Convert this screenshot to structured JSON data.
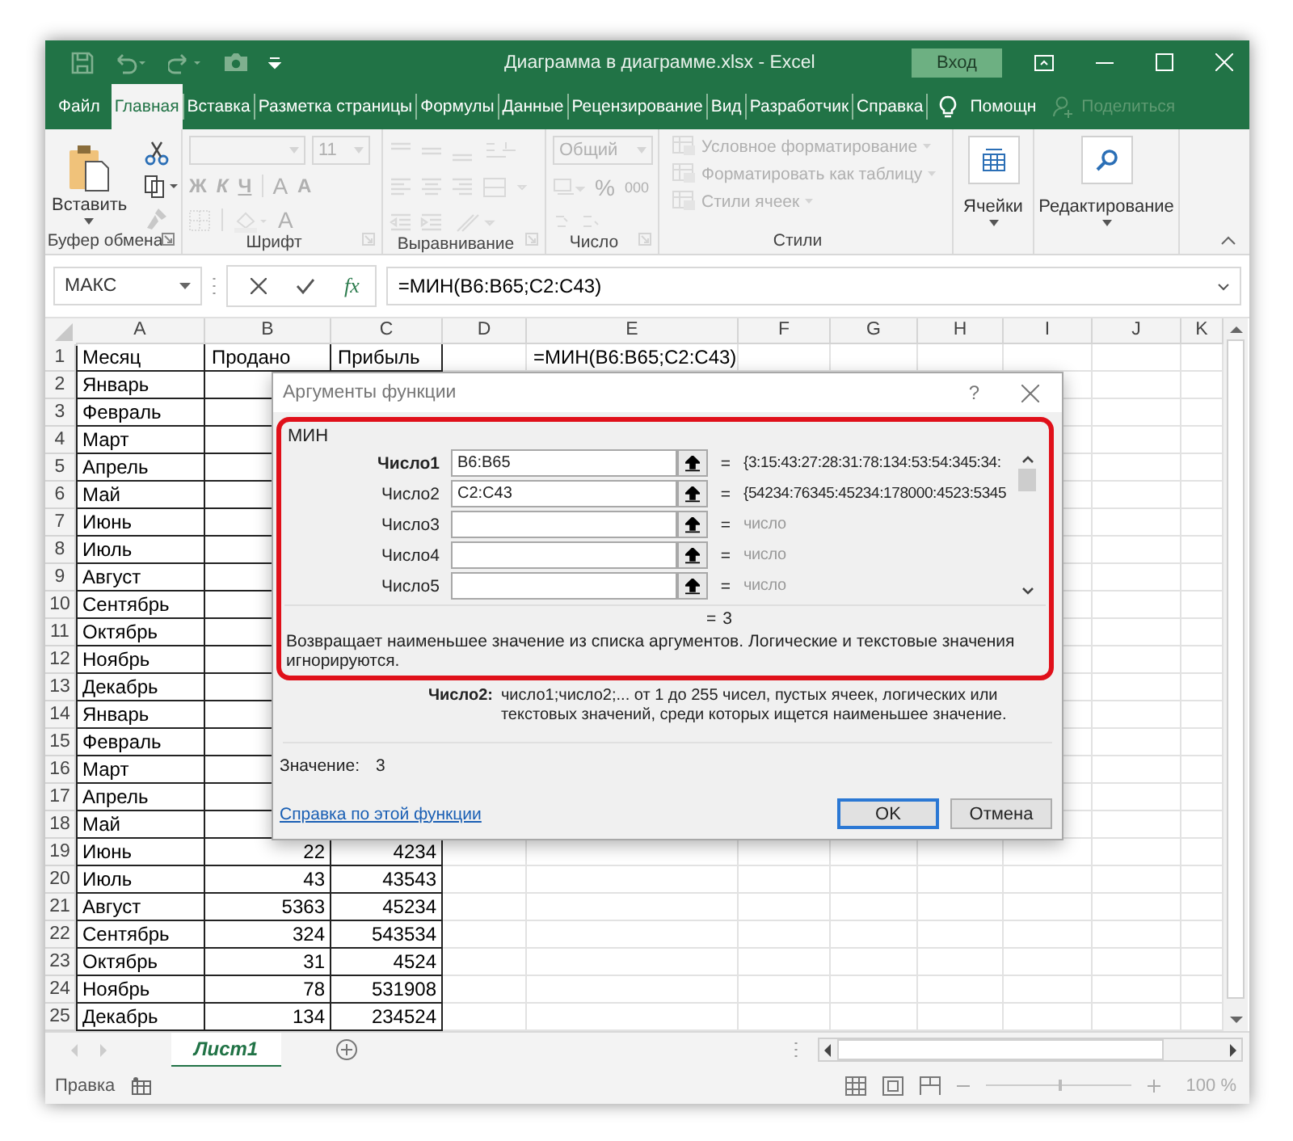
{
  "window": {
    "title": "Диаграмма в диаграмме.xlsx  -  Excel",
    "sign_in": "Вход"
  },
  "ribbon_tabs": [
    {
      "label": "Файл",
      "selected": false
    },
    {
      "label": "Главная",
      "selected": true
    },
    {
      "label": "Вставка",
      "selected": false
    },
    {
      "label": "Разметка страницы",
      "selected": false
    },
    {
      "label": "Формулы",
      "selected": false
    },
    {
      "label": "Данные",
      "selected": false
    },
    {
      "label": "Рецензирование",
      "selected": false
    },
    {
      "label": "Вид",
      "selected": false
    },
    {
      "label": "Разработчик",
      "selected": false
    },
    {
      "label": "Справка",
      "selected": false
    }
  ],
  "tell_me": "Помощн",
  "share": {
    "label": "Поделиться",
    "disabled": true
  },
  "ribbon": {
    "clipboard": {
      "label": "Буфер обмена",
      "paste": "Вставить",
      "disabled": false
    },
    "font": {
      "label": "Шрифт",
      "size": "11",
      "bold": "Ж",
      "italic": "К",
      "underline": "Ч",
      "grow": "A",
      "shrink": "A",
      "font_color": "A",
      "disabled": true
    },
    "alignment": {
      "label": "Выравнивание",
      "disabled": true
    },
    "number": {
      "label": "Число",
      "format": "Общий",
      "percent": "%",
      "thousands": "000",
      "disabled": true
    },
    "styles": {
      "label": "Стили",
      "items": [
        "Условное форматирование",
        "Форматировать как таблицу",
        "Стили ячеек"
      ],
      "disabled": true
    },
    "cells": {
      "label": "Ячейки",
      "disabled": false
    },
    "editing": {
      "label": "Редактирование",
      "disabled": false
    }
  },
  "formula_bar": {
    "name_box": "МАКС",
    "fx": "fx",
    "formula": "=МИН(B6:B65;C2:C43)"
  },
  "sheet": {
    "columns": [
      "A",
      "B",
      "C",
      "D",
      "E",
      "F",
      "G",
      "H",
      "I",
      "J",
      "K"
    ],
    "rows": [
      {
        "num": "1",
        "a": "Месяц",
        "b": "Продано",
        "c": "Прибыль",
        "e": "=МИН(B6:B65;C2:C43)"
      },
      {
        "num": "2",
        "a": "Январь"
      },
      {
        "num": "3",
        "a": "Февраль"
      },
      {
        "num": "4",
        "a": "Март"
      },
      {
        "num": "5",
        "a": "Апрель"
      },
      {
        "num": "6",
        "a": "Май"
      },
      {
        "num": "7",
        "a": "Июнь"
      },
      {
        "num": "8",
        "a": "Июль"
      },
      {
        "num": "9",
        "a": "Август"
      },
      {
        "num": "10",
        "a": "Сентябрь"
      },
      {
        "num": "11",
        "a": "Октябрь"
      },
      {
        "num": "12",
        "a": "Ноябрь"
      },
      {
        "num": "13",
        "a": "Декабрь"
      },
      {
        "num": "14",
        "a": "Январь"
      },
      {
        "num": "15",
        "a": "Февраль"
      },
      {
        "num": "16",
        "a": "Март"
      },
      {
        "num": "17",
        "a": "Апрель"
      },
      {
        "num": "18",
        "a": "Май"
      },
      {
        "num": "19",
        "a": "Июнь",
        "b": "22",
        "c": "4234"
      },
      {
        "num": "20",
        "a": "Июль",
        "b": "43",
        "c": "43543"
      },
      {
        "num": "21",
        "a": "Август",
        "b": "5363",
        "c": "45234"
      },
      {
        "num": "22",
        "a": "Сентябрь",
        "b": "324",
        "c": "543534"
      },
      {
        "num": "23",
        "a": "Октябрь",
        "b": "31",
        "c": "4524"
      },
      {
        "num": "24",
        "a": "Ноябрь",
        "b": "78",
        "c": "531908"
      },
      {
        "num": "25",
        "a": "Декабрь",
        "b": "134",
        "c": "234524"
      }
    ]
  },
  "dialog": {
    "title": "Аргументы функции",
    "help": "?",
    "function_name": "МИН",
    "arguments": [
      {
        "label": "Число1",
        "required": true,
        "value": "B6:B65",
        "eq": "=",
        "result": "{3:15:43:27:28:31:78:134:53:54:345:34:"
      },
      {
        "label": "Число2",
        "required": false,
        "value": "C2:C43",
        "eq": "=",
        "result": "{54234:76345:45234:178000:4523:5345"
      },
      {
        "label": "Число3",
        "required": false,
        "eq": "=",
        "result": "число"
      },
      {
        "label": "Число4",
        "required": false,
        "eq": "=",
        "result": "число"
      },
      {
        "label": "Число5",
        "required": false,
        "eq": "=",
        "result": "число"
      }
    ],
    "result_eq": "=",
    "result": "3",
    "description": "Возвращает наименьшее значение из списка аргументов. Логические и текстовые значения игнорируются.",
    "arg_name": "Число2:",
    "arg_description": "число1;число2;... от 1 до 255 чисел, пустых ячеек, логических или текстовых значений, среди которых ищется наименьшее значение.",
    "value_label": "Значение:",
    "value": "3",
    "help_link": "Справка по этой функции",
    "buttons": [
      {
        "label": "OK",
        "default": true
      },
      {
        "label": "Отмена",
        "default": false
      }
    ]
  },
  "sheet_tabs": [
    {
      "label": "Лист1",
      "selected": true
    }
  ],
  "status_bar": {
    "mode": "Правка",
    "zoom": {
      "level": 0.5,
      "reading": "100 %"
    }
  }
}
